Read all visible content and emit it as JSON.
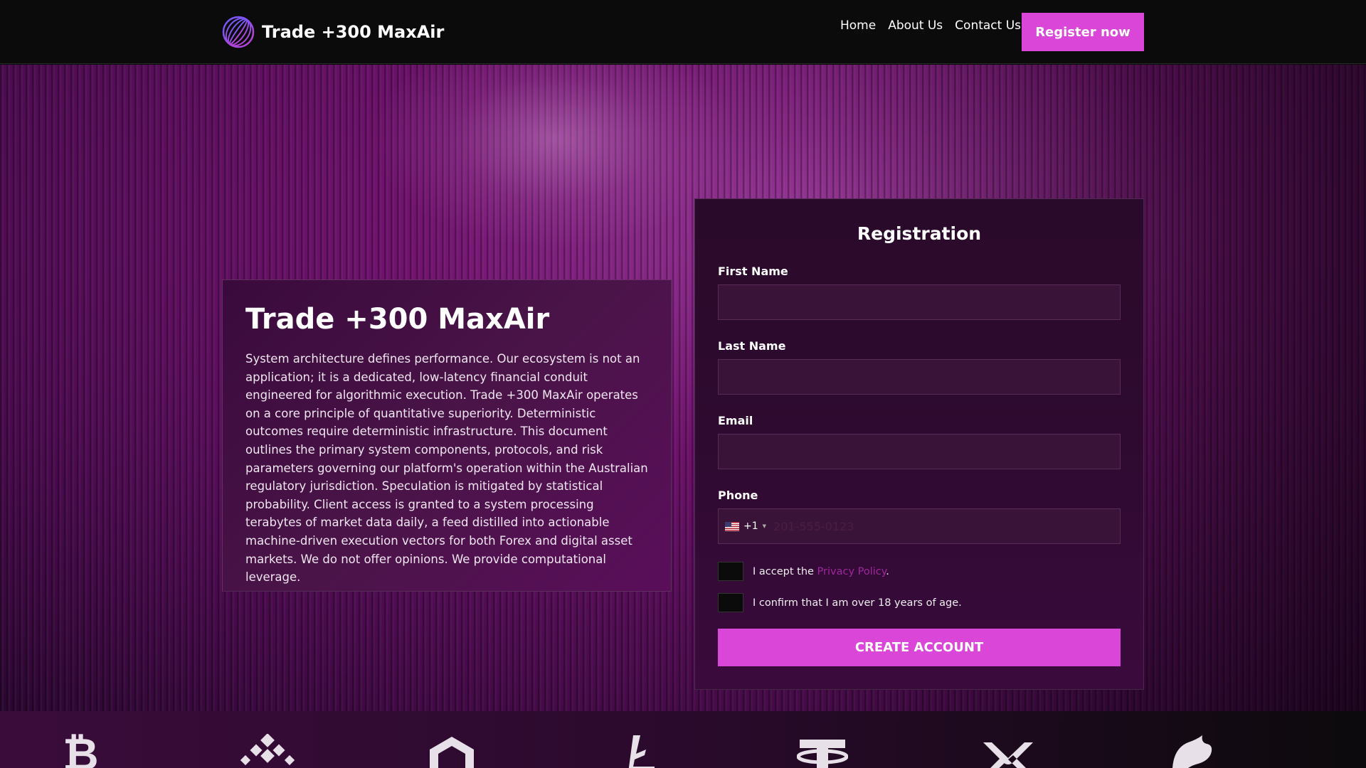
{
  "header": {
    "brand_name": "Trade +300 MaxAir",
    "nav": [
      "Home",
      "About Us",
      "Contact Us"
    ],
    "register_label": "Register now"
  },
  "hero": {
    "title": "Trade +300 MaxAir",
    "description": "System architecture defines performance. Our ecosystem is not an application; it is a dedicated, low-latency financial conduit engineered for algorithmic execution. Trade +300 MaxAir operates on a core principle of quantitative superiority. Deterministic outcomes require deterministic infrastructure. This document outlines the primary system components, protocols, and risk parameters governing our platform's operation within the Australian regulatory jurisdiction. Speculation is mitigated by statistical probability. Client access is granted to a system processing terabytes of market data daily, a feed distilled into actionable machine-driven execution vectors for both Forex and digital asset markets. We do not offer opinions. We provide computational leverage."
  },
  "form": {
    "title": "Registration",
    "first_name_label": "First Name",
    "last_name_label": "Last Name",
    "email_label": "Email",
    "phone_label": "Phone",
    "dial_code": "+1",
    "phone_placeholder": "201-555-0123",
    "privacy_prefix": "I accept the ",
    "privacy_link": "Privacy Policy",
    "privacy_suffix": ".",
    "age_confirm": "I confirm that I am over 18 years of age.",
    "submit_label": "CREATE ACCOUNT"
  },
  "coins": [
    "bitcoin-icon",
    "binance-icon",
    "chainlink-icon",
    "litecoin-icon",
    "tether-icon",
    "xrp-icon",
    "uniswap-icon"
  ],
  "colors": {
    "accent": "#d946d8",
    "header_bg": "#0b0b0b",
    "link": "#a0289e"
  }
}
